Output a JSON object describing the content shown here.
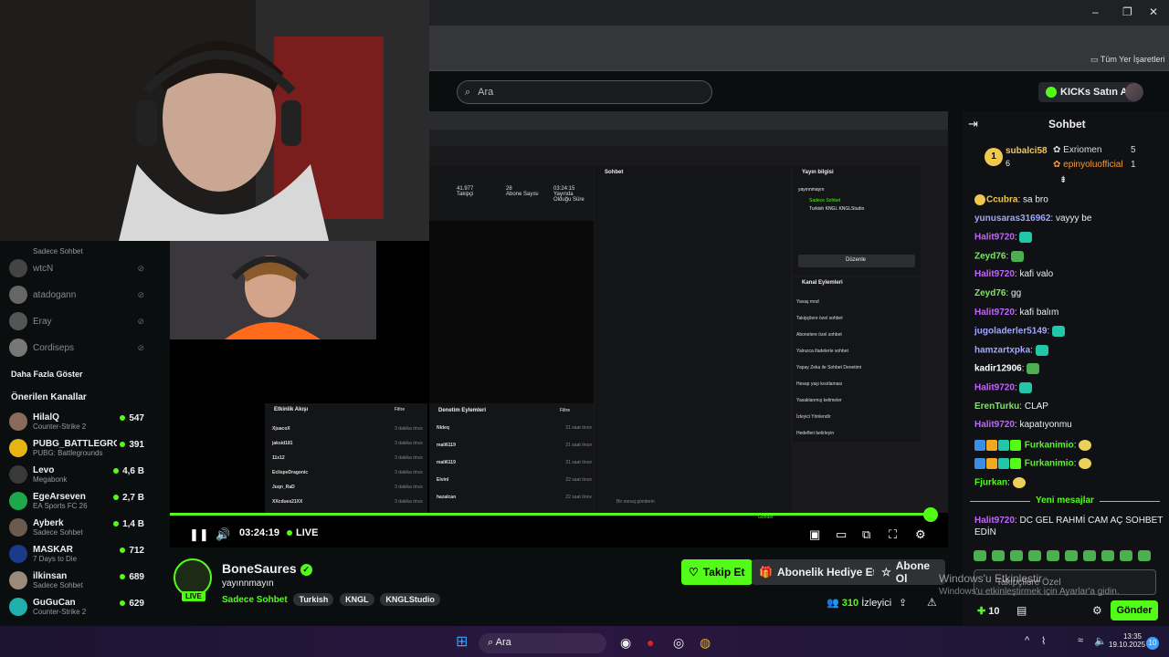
{
  "browser": {
    "bookmarks_label": "Tüm Yer İşaretleri"
  },
  "header": {
    "search_placeholder": "Ara",
    "kicks_label": "KICKs Satın Al"
  },
  "sidebar": {
    "followed": [
      {
        "name": "",
        "sub": "Sadece Sohbet"
      },
      {
        "name": "wtcN",
        "sub": ""
      },
      {
        "name": "atadogann",
        "sub": ""
      },
      {
        "name": "Eray",
        "sub": ""
      },
      {
        "name": "Cordiseps",
        "sub": ""
      }
    ],
    "show_more": "Daha Fazla Göster",
    "recommended_title": "Önerilen Kanallar",
    "recommended": [
      {
        "name": "HilalQ",
        "sub": "Counter-Strike 2",
        "viewers": "547"
      },
      {
        "name": "PUBG_BATTLEGRO...",
        "sub": "PUBG: Battlegrounds",
        "viewers": "391"
      },
      {
        "name": "Levo",
        "sub": "Megabonk",
        "viewers": "4,6 B"
      },
      {
        "name": "EgeArseven",
        "sub": "EA Sports FC 26",
        "viewers": "2,7 B"
      },
      {
        "name": "Ayberk",
        "sub": "Sadece Sohbet",
        "viewers": "1,4 B"
      },
      {
        "name": "MASKAR",
        "sub": "7 Days to Die",
        "viewers": "712"
      },
      {
        "name": "ilkinsan",
        "sub": "Sadece Sohbet",
        "viewers": "689"
      },
      {
        "name": "GuGuCan",
        "sub": "Counter-Strike 2",
        "viewers": "629"
      }
    ]
  },
  "player": {
    "time": "03:24:19",
    "live": "LIVE"
  },
  "stream_screen": {
    "stats": [
      {
        "value": "41.977",
        "label": "Takipçi"
      },
      {
        "value": "28",
        "label": "Abone Sayısı"
      },
      {
        "value": "03:24:15",
        "label": "Yayında Olduğu Süre"
      }
    ],
    "chat_title": "Sohbet",
    "info_title": "Yayın bilgisi",
    "info_sub": "yayınnmayın",
    "info_cat": "Sadece Sohbet",
    "info_tags": [
      "Turkish",
      "KNGL",
      "KNGLStudio"
    ],
    "edit": "Düzenle",
    "actions_title": "Kanal Eylemleri",
    "actions": [
      "Yavaş mod",
      "Takipçilere özel sohbet",
      "Abonelere özel sohbet",
      "Yalnızca ifadelerle sohbet",
      "Yapay Zeka ile Sohbet Denetimi",
      "Hesap yaşı kısıtlaması",
      "Yasaklanmış kelimeler",
      "İzleyici Yönlendir",
      "Hedefleri belirleyin"
    ],
    "activity_title": "Etkinlik Akışı",
    "activity_filter": "Filtre",
    "activity": [
      {
        "user": "XjuacoX",
        "text": "kanalı takip etti",
        "time": "3 dakika önce"
      },
      {
        "user": "jaksid181",
        "text": "kanalı takip etti",
        "time": "3 dakika önce"
      },
      {
        "user": "11x12",
        "text": "kanalı takip etti",
        "time": "3 dakika önce"
      },
      {
        "user": "EclispeDragonic",
        "text": "kanalı takip etti",
        "time": "3 dakika önce"
      },
      {
        "user": "Juqn_RaD",
        "text": "kanalı takip etti",
        "time": "3 dakika önce"
      },
      {
        "user": "XXcdues21XX",
        "text": "",
        "time": "3 dakika önce"
      }
    ],
    "mod_title": "Denetim Eylemleri",
    "mod": [
      {
        "user": "Nldeq",
        "text": "Ehdef tarafından 5 dakika süreliğine sohbetten uzaklaştırıldı",
        "time": "21 saat önce"
      },
      {
        "user": "mali6119",
        "text": "jollentoltamiko tarafından 5 dakika süreliğine sohbetten uzaklaştırıldı",
        "time": "21 saat önce"
      },
      {
        "user": "mali6119",
        "text": "Dizzi tarafından 1 saat süreliğine sohbetten uzaklaştırıldı",
        "time": "21 saat önce"
      },
      {
        "user": "Elvinl",
        "text": "bir mesajı sildi",
        "time": "22 saat önce"
      },
      {
        "user": "hazalcan",
        "text": "bir mesajı sildi",
        "time": "22 saat önce"
      }
    ],
    "send_placeholder": "Bir mesaj gönderin",
    "send": "Gönder",
    "follower_only": "Takipçilere Özel"
  },
  "channel": {
    "name": "BoneSaures",
    "title": "yayınnmayın",
    "category": "Sadece Sohbet",
    "tags": [
      "Turkish",
      "KNGL",
      "KNGLStudio"
    ],
    "live": "LIVE",
    "follow": "Takip Et",
    "gift": "Abonelik Hediye Et",
    "subscribe": "Abone Ol",
    "viewers": "310",
    "viewers_label": "İzleyici"
  },
  "chat": {
    "title": "Sohbet",
    "top_gifters": [
      {
        "name": "subalci58",
        "value": "6"
      },
      {
        "name": "Exriomen",
        "value": "5"
      },
      {
        "name": "epinyoluofficial",
        "value": "1"
      }
    ],
    "messages": [
      {
        "user": "Ccubra",
        "color": "#efc94c",
        "text": "sa bro"
      },
      {
        "user": "yunusaras316962",
        "color": "#9fa8ff",
        "text": "vayyy be"
      },
      {
        "user": "Halit9720",
        "color": "#c264fe",
        "text": ""
      },
      {
        "user": "Zeyd76",
        "color": "#7ee860",
        "text": ""
      },
      {
        "user": "Halit9720",
        "color": "#c264fe",
        "text": "kafi valo"
      },
      {
        "user": "Zeyd76",
        "color": "#7ee860",
        "text": "gg"
      },
      {
        "user": "Halit9720",
        "color": "#c264fe",
        "text": "kafi balım"
      },
      {
        "user": "jugoladerler5149",
        "color": "#9fa8ff",
        "text": ""
      },
      {
        "user": "hamzartxpka",
        "color": "#9fa8ff",
        "text": ""
      },
      {
        "user": "kadir12906",
        "color": "#ffffff",
        "text": ""
      },
      {
        "user": "Halit9720",
        "color": "#c264fe",
        "text": ""
      },
      {
        "user": "ErenTurku",
        "color": "#7ee860",
        "text": "CLAP"
      },
      {
        "user": "Halit9720",
        "color": "#c264fe",
        "text": "kapatıyonmu"
      },
      {
        "user": "Furkanimio",
        "color": "#53fc18",
        "text": ""
      },
      {
        "user": "Furkanimio",
        "color": "#53fc18",
        "text": ""
      },
      {
        "user": "Fjurkan",
        "color": "#53fc18",
        "text": ""
      }
    ],
    "new_messages": "Yeni mesajlar",
    "last_user": "Halit9720",
    "last_text_1": "DC GEL RAHMİ CAM AÇ SOHBET",
    "last_text_2": "EDİN",
    "input_placeholder": "Takipçilere Özel",
    "kicks_count": "10",
    "send": "Gönder"
  },
  "windows": {
    "activate_1": "Windows'u Etkinleştir",
    "activate_2": "Windows'u etkinleştirmek için Ayarlar'a gidin.",
    "taskbar_search": "Ara",
    "time": "13:35",
    "date": "19.10.2025",
    "notif": "10"
  }
}
